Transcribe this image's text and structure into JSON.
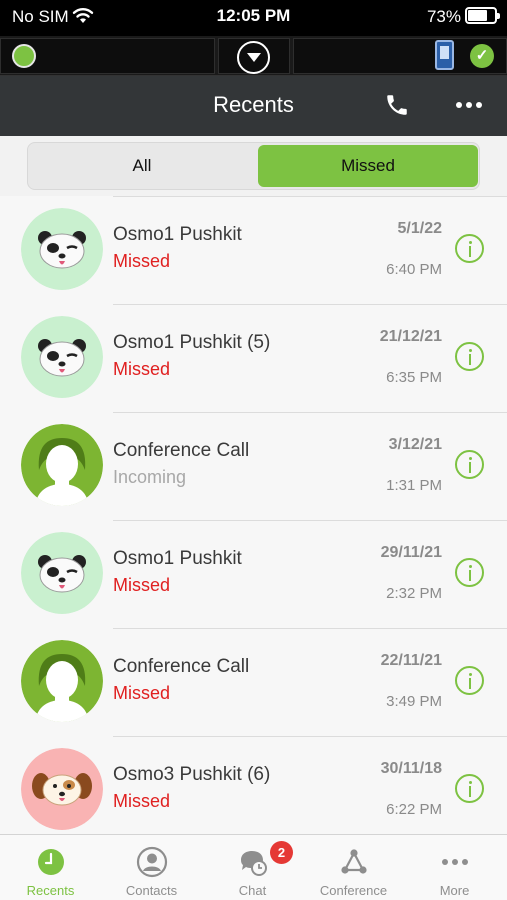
{
  "status_bar": {
    "carrier": "No SIM",
    "time": "12:05 PM",
    "battery": "73%",
    "battery_level": 0.73
  },
  "nav": {
    "title": "Recents"
  },
  "segments": {
    "all": "All",
    "missed": "Missed",
    "selected": "missed"
  },
  "recents": [
    {
      "name": "Osmo1 Pushkit",
      "status": "Missed",
      "date": "5/1/22",
      "time": "6:40 PM",
      "avatar": "panda",
      "status_type": "missed"
    },
    {
      "name": "Osmo1 Pushkit (5)",
      "status": "Missed",
      "date": "21/12/21",
      "time": "6:35 PM",
      "avatar": "panda",
      "status_type": "missed"
    },
    {
      "name": "Conference Call",
      "status": "Incoming",
      "date": "3/12/21",
      "time": "1:31 PM",
      "avatar": "person",
      "status_type": "incoming"
    },
    {
      "name": "Osmo1 Pushkit",
      "status": "Missed",
      "date": "29/11/21",
      "time": "2:32 PM",
      "avatar": "panda",
      "status_type": "missed"
    },
    {
      "name": "Conference Call",
      "status": "Missed",
      "date": "22/11/21",
      "time": "3:49 PM",
      "avatar": "person",
      "status_type": "missed"
    },
    {
      "name": "Osmo3 Pushkit (6)",
      "status": "Missed",
      "date": "30/11/18",
      "time": "6:22 PM",
      "avatar": "puppy",
      "status_type": "missed"
    }
  ],
  "tab_bar": {
    "tabs": [
      {
        "label": "Recents",
        "icon": "clock-icon",
        "active": true
      },
      {
        "label": "Contacts",
        "icon": "person-icon",
        "active": false
      },
      {
        "label": "Chat",
        "icon": "chat-icon",
        "active": false
      },
      {
        "label": "Conference",
        "icon": "conference-icon",
        "active": false
      },
      {
        "label": "More",
        "icon": "more-icon",
        "active": false
      }
    ],
    "chat_badge": "2"
  },
  "colors": {
    "accent": "#7dc242",
    "missed": "#e02020",
    "incoming": "#a8a8a8",
    "nav_bg": "#333638"
  }
}
